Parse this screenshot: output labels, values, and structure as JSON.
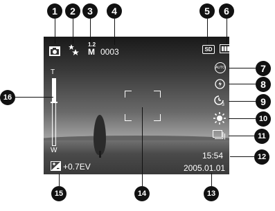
{
  "callouts": [
    "1",
    "2",
    "3",
    "4",
    "5",
    "6",
    "7",
    "8",
    "9",
    "10",
    "11",
    "12",
    "13",
    "14",
    "15",
    "16"
  ],
  "status_bar": {
    "camera_mode_icon": "camera-icon",
    "quality_icon": "quality-stars-icon",
    "resolution_top": "1.2",
    "resolution_bottom": "M",
    "shots_remaining": "0003",
    "storage_label": "SD",
    "battery_icon": "battery-icon"
  },
  "side_icons": {
    "flash_mode": "AUTO",
    "red_eye_icon": "red-eye-icon",
    "self_timer_sub": "3",
    "white_balance_icon": "sun-icon",
    "drive_mode_icon": "burst-icon"
  },
  "zoom": {
    "tele_label": "T",
    "wide_label": "W",
    "level": 0.35
  },
  "exposure": {
    "value": "+0.7EV",
    "icon": "exposure-compensation-icon"
  },
  "time": "15:54",
  "date": "2005.01.01",
  "colors": {
    "overlay": "#ffffff",
    "callout_bg": "#111111"
  }
}
